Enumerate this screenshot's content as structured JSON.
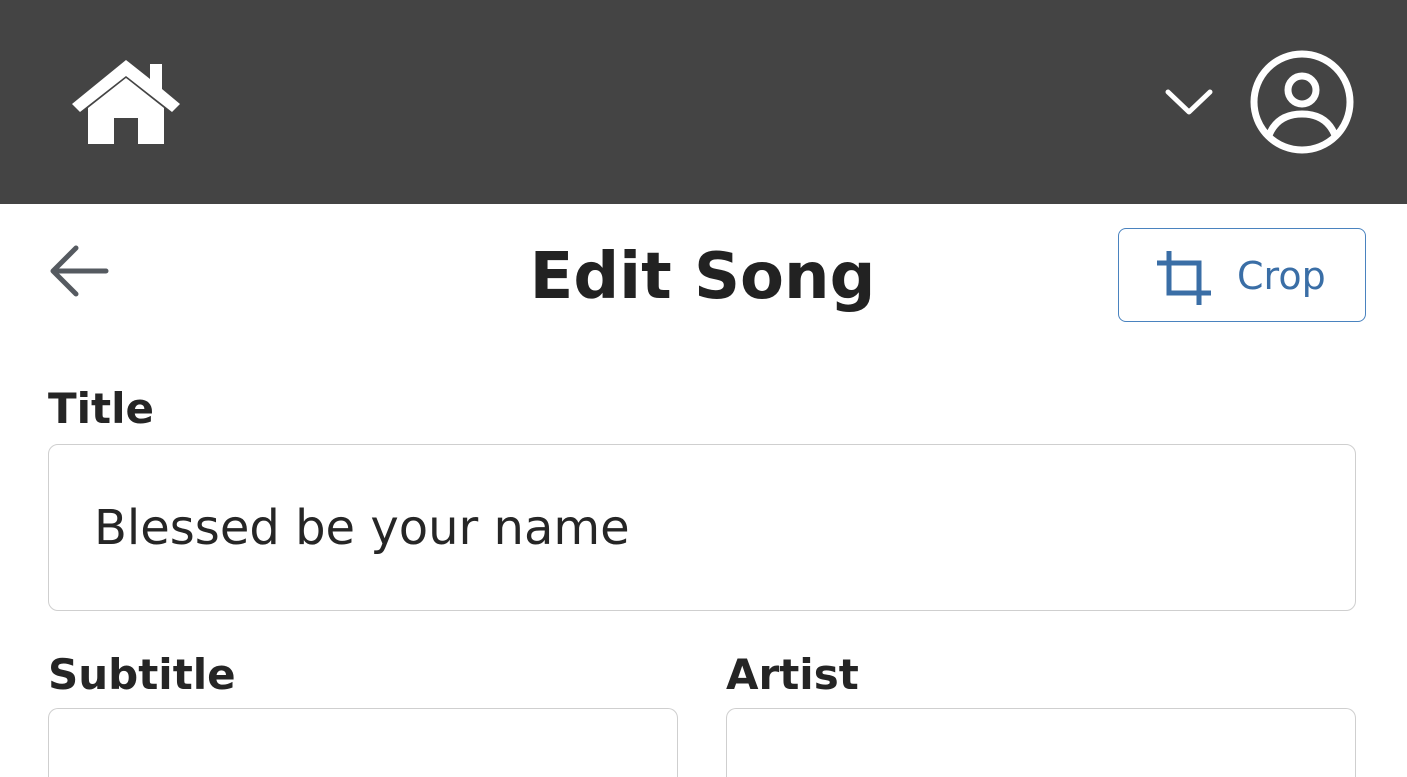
{
  "header": {
    "icons": {
      "home": "home-icon",
      "menu": "chevron-down-icon",
      "account": "user-circle-icon"
    },
    "background_color": "#444444"
  },
  "page": {
    "title": "Edit Song",
    "back_icon": "arrow-left-icon",
    "crop_button": {
      "label": "Crop",
      "icon": "crop-icon",
      "color": "#3a6ea6"
    }
  },
  "form": {
    "title": {
      "label": "Title",
      "value": "Blessed be your name"
    },
    "subtitle": {
      "label": "Subtitle",
      "value": ""
    },
    "artist": {
      "label": "Artist",
      "value": ""
    }
  }
}
